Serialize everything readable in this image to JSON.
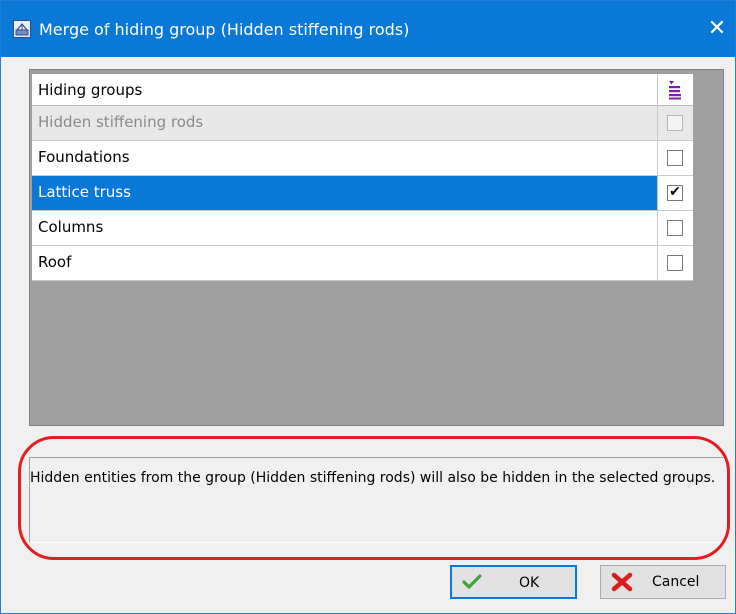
{
  "window": {
    "title": "Merge of hiding group (Hidden stiffening rods)",
    "close_glyph": "✕",
    "app_icon": "hiding-group-app-icon",
    "accent_color": "#0a78d7"
  },
  "grid": {
    "column_header": "Hiding groups",
    "header_icon": "sort-lines-icon",
    "rows": [
      {
        "label": "Hidden stiffening rods",
        "checked": false,
        "disabled": true,
        "selected": false,
        "check_glyph": ""
      },
      {
        "label": "Foundations",
        "checked": false,
        "disabled": false,
        "selected": false,
        "check_glyph": ""
      },
      {
        "label": "Lattice truss",
        "checked": true,
        "disabled": false,
        "selected": true,
        "check_glyph": "✔"
      },
      {
        "label": "Columns",
        "checked": false,
        "disabled": false,
        "selected": false,
        "check_glyph": ""
      },
      {
        "label": "Roof",
        "checked": false,
        "disabled": false,
        "selected": false,
        "check_glyph": ""
      }
    ]
  },
  "info": {
    "text": "Hidden entities from the group (Hidden stiffening rods) will also be hidden in the selected groups.",
    "highlight_color": "#e41e1e"
  },
  "buttons": {
    "ok_label": "OK",
    "ok_icon": "checkmark-icon",
    "cancel_label": "Cancel",
    "cancel_icon": "red-x-icon"
  }
}
